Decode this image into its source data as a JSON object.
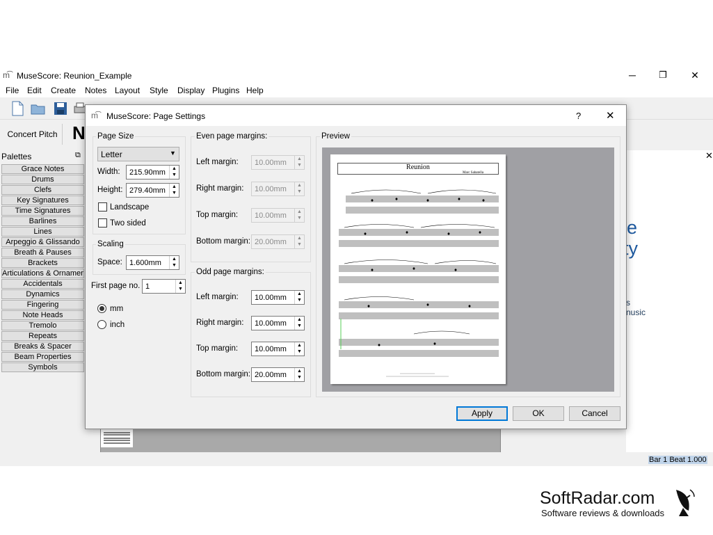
{
  "window": {
    "title": "MuseScore: Reunion_Example",
    "minimize": "─",
    "maximize": "❐",
    "close": "✕"
  },
  "menu": [
    "File",
    "Edit",
    "Create",
    "Notes",
    "Layout",
    "Style",
    "Display",
    "Plugins",
    "Help"
  ],
  "toolbar": {
    "concert_pitch": "Concert Pitch",
    "big_letter": "N"
  },
  "palettes": {
    "title": "Palettes",
    "items": [
      "Grace Notes",
      "Drums",
      "Clefs",
      "Key Signatures",
      "Time Signatures",
      "Barlines",
      "Lines",
      "Arpeggio & Glissando",
      "Breath & Pauses",
      "Brackets",
      "Articulations & Ornaments",
      "Accidentals",
      "Dynamics",
      "Fingering",
      "Note Heads",
      "Tremolo",
      "Repeats",
      "Breaks & Spacer",
      "Beam Properties",
      "Symbols"
    ]
  },
  "right_panel": {
    "close": "✕",
    "line1": "n the",
    "line2": "ty",
    "line3": "s",
    "line4": "nusic"
  },
  "status": {
    "text": "Bar   1 Beat  1.000"
  },
  "dialog": {
    "title": "MuseScore: Page Settings",
    "help": "?",
    "close": "✕",
    "page_size": {
      "label": "Page Size",
      "selected": "Letter",
      "width_label": "Width:",
      "width": "215.90mm",
      "height_label": "Height:",
      "height": "279.40mm",
      "landscape": "Landscape",
      "two_sided": "Two sided",
      "landscape_checked": false,
      "two_sided_checked": false
    },
    "scaling": {
      "label": "Scaling",
      "space_label": "Space:",
      "space": "1.600mm"
    },
    "first_page": {
      "label": "First page no.",
      "value": "1"
    },
    "units": {
      "mm": "mm",
      "inch": "inch",
      "selected": "mm"
    },
    "even": {
      "label": "Even page margins:",
      "left_label": "Left margin:",
      "left": "10.00mm",
      "right_label": "Right margin:",
      "right": "10.00mm",
      "top_label": "Top margin:",
      "top": "10.00mm",
      "bottom_label": "Bottom margin:",
      "bottom": "20.00mm"
    },
    "odd": {
      "label": "Odd page margins:",
      "left_label": "Left margin:",
      "left": "10.00mm",
      "right_label": "Right margin:",
      "right": "10.00mm",
      "top_label": "Top margin:",
      "top": "10.00mm",
      "bottom_label": "Bottom margin:",
      "bottom": "20.00mm"
    },
    "preview": {
      "label": "Preview",
      "score_title": "Reunion",
      "composer": "Marc Sabatella"
    },
    "buttons": {
      "apply": "Apply",
      "ok": "OK",
      "cancel": "Cancel"
    }
  },
  "watermark": {
    "brand": "SoftRadar.com",
    "tagline": "Software reviews & downloads"
  }
}
